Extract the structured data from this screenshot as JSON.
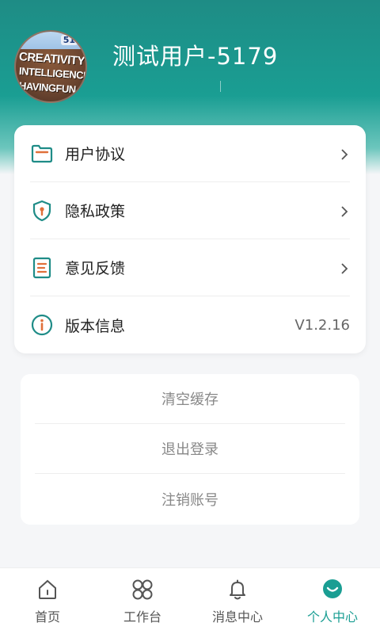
{
  "profile": {
    "avatar_lines": [
      "CREATIVITY",
      "INTELLIGENCE",
      "HAVINGFUN"
    ],
    "avatar_tag": "51",
    "username": "测试用户-5179"
  },
  "menu": {
    "items": [
      {
        "label": "用户协议",
        "icon": "folder-icon"
      },
      {
        "label": "隐私政策",
        "icon": "shield-icon"
      },
      {
        "label": "意见反馈",
        "icon": "feedback-doc-icon"
      },
      {
        "label": "版本信息",
        "icon": "info-icon",
        "value": "V1.2.16"
      }
    ]
  },
  "actions": {
    "clear_cache": "清空缓存",
    "logout": "退出登录",
    "delete_account": "注销账号"
  },
  "tabbar": {
    "items": [
      {
        "label": "首页",
        "icon": "home-icon"
      },
      {
        "label": "工作台",
        "icon": "workbench-icon"
      },
      {
        "label": "消息中心",
        "icon": "bell-icon"
      },
      {
        "label": "个人中心",
        "icon": "profile-icon",
        "active": true
      }
    ]
  },
  "colors": {
    "accent": "#1a9e93",
    "icon_teal": "#1f8c87",
    "icon_orange": "#e0703a"
  }
}
